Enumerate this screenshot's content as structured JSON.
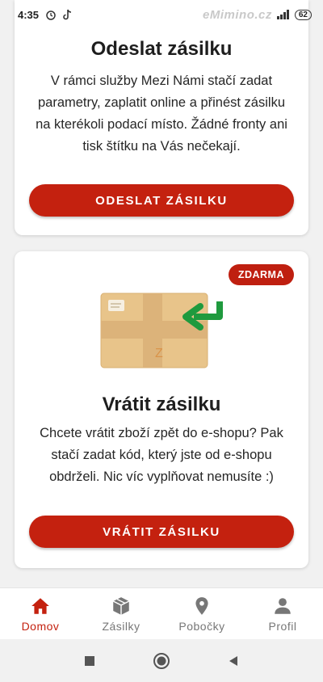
{
  "status_bar": {
    "time": "4:35",
    "watermark": "eMimino.cz",
    "battery": "62"
  },
  "send_card": {
    "title": "Odeslat zásilku",
    "description": "V rámci služby Mezi Námi stačí zadat parametry, zaplatit online a přinést zásilku na kterékoli podací místo. Žádné fronty ani tisk štítku na Vás nečekají.",
    "button_label": "ODESLAT ZÁSILKU"
  },
  "return_card": {
    "badge": "ZDARMA",
    "parcel_letter": "Z",
    "title": "Vrátit zásilku",
    "description": "Chcete vrátit zboží zpět do e-shopu? Pak stačí zadat kód, který jste od e-shopu obdrželi. Nic víc vyplňovat nemusíte :)",
    "button_label": "VRÁTIT ZÁSILKU"
  },
  "bottom_nav": {
    "items": [
      {
        "label": "Domov",
        "icon": "home-icon",
        "active": true
      },
      {
        "label": "Zásilky",
        "icon": "package-icon",
        "active": false
      },
      {
        "label": "Pobočky",
        "icon": "location-pin-icon",
        "active": false
      },
      {
        "label": "Profil",
        "icon": "person-icon",
        "active": false
      }
    ]
  },
  "colors": {
    "accent": "#c4210f",
    "nav_inactive": "#777777",
    "parcel": "#e8c48a",
    "arrow": "#1f9a3e"
  }
}
